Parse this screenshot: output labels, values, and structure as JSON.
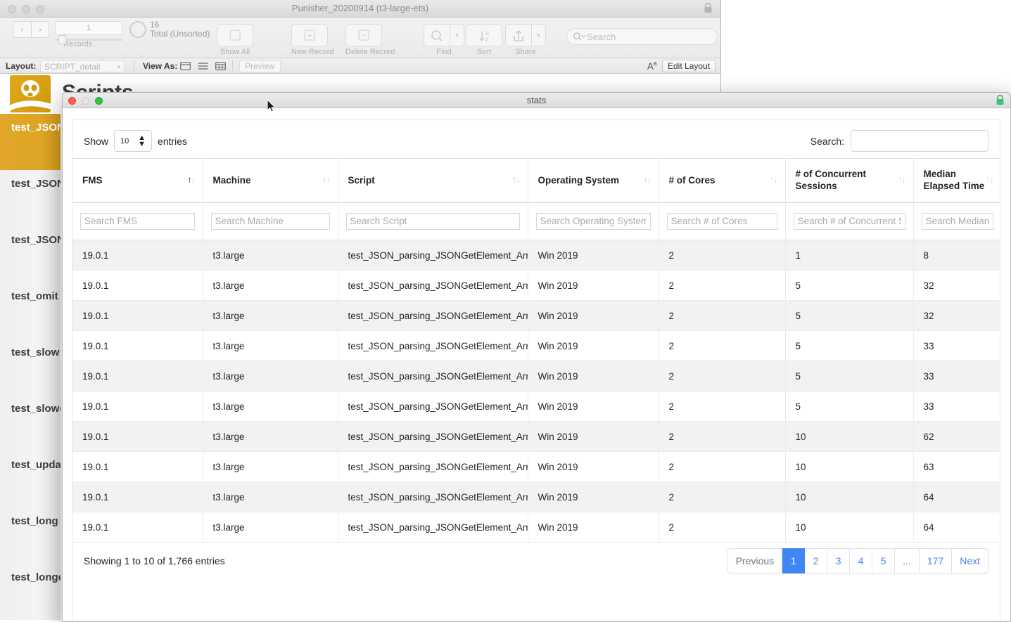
{
  "fm_window": {
    "title": "Punisher_20200914 (t3-large-ets)",
    "lock_icon": "lock-icon",
    "toolbar": {
      "record_index": "1",
      "record_total": "16",
      "record_total_label": "Total (Unsorted)",
      "records_label": "Records",
      "show_all_label": "Show All",
      "new_record_label": "New Record",
      "delete_record_label": "Delete Record",
      "find_label": "Find",
      "sort_label": "Sort",
      "share_label": "Share",
      "search_placeholder": "Search"
    },
    "layout_bar": {
      "layout_label": "Layout:",
      "layout_value": "SCRIPT_detail",
      "view_as_label": "View As:",
      "preview_label": "Preview",
      "text_format_icon": "text-format-icon",
      "edit_layout_label": "Edit Layout"
    },
    "body": {
      "heading": "Scripts",
      "logo_icon": "skull-logo-icon",
      "script_items": [
        {
          "label": "test_JSON_parsing_JSONGetElement_Array",
          "selected": true
        },
        {
          "label": "test_JSON_parsing_JSONGetElement_Object",
          "selected": false
        },
        {
          "label": "test_JSON_parsing_JSONGetElement_Nested",
          "selected": false
        },
        {
          "label": "test_omit",
          "selected": false
        },
        {
          "label": "test_slow",
          "selected": false
        },
        {
          "label": "test_slower",
          "selected": false
        },
        {
          "label": "test_update",
          "selected": false
        },
        {
          "label": "test_long",
          "selected": false
        },
        {
          "label": "test_longer",
          "selected": false
        }
      ]
    }
  },
  "stats_window": {
    "title": "stats",
    "lock_icon": "lock-icon-green",
    "traffic_lights": [
      "close",
      "minimize",
      "maximize"
    ],
    "datatable": {
      "length_prefix": "Show",
      "length_value": "10",
      "length_suffix": "entries",
      "filter_label": "Search:",
      "filter_value": "",
      "columns": [
        {
          "label": "FMS",
          "search_placeholder": "Search FMS",
          "sorted": "asc"
        },
        {
          "label": "Machine",
          "search_placeholder": "Search Machine",
          "sorted": "none"
        },
        {
          "label": "Script",
          "search_placeholder": "Search Script",
          "sorted": "none"
        },
        {
          "label": "Operating System",
          "search_placeholder": "Search Operating System",
          "sorted": "none"
        },
        {
          "label": "# of Cores",
          "search_placeholder": "Search # of Cores",
          "sorted": "none"
        },
        {
          "label": "# of Concurrent Sessions",
          "search_placeholder": "Search # of Concurrent Se",
          "sorted": "none"
        },
        {
          "label": "Median Elapsed Time",
          "search_placeholder": "Search Median Elapsed Time",
          "sorted": "none"
        }
      ],
      "rows": [
        [
          "19.0.1",
          "t3.large",
          "test_JSON_parsing_JSONGetElement_Array",
          "Win 2019",
          "2",
          "1",
          "8"
        ],
        [
          "19.0.1",
          "t3.large",
          "test_JSON_parsing_JSONGetElement_Array",
          "Win 2019",
          "2",
          "5",
          "32"
        ],
        [
          "19.0.1",
          "t3.large",
          "test_JSON_parsing_JSONGetElement_Array",
          "Win 2019",
          "2",
          "5",
          "32"
        ],
        [
          "19.0.1",
          "t3.large",
          "test_JSON_parsing_JSONGetElement_Array",
          "Win 2019",
          "2",
          "5",
          "33"
        ],
        [
          "19.0.1",
          "t3.large",
          "test_JSON_parsing_JSONGetElement_Array",
          "Win 2019",
          "2",
          "5",
          "33"
        ],
        [
          "19.0.1",
          "t3.large",
          "test_JSON_parsing_JSONGetElement_Array",
          "Win 2019",
          "2",
          "5",
          "33"
        ],
        [
          "19.0.1",
          "t3.large",
          "test_JSON_parsing_JSONGetElement_Array",
          "Win 2019",
          "2",
          "10",
          "62"
        ],
        [
          "19.0.1",
          "t3.large",
          "test_JSON_parsing_JSONGetElement_Array",
          "Win 2019",
          "2",
          "10",
          "63"
        ],
        [
          "19.0.1",
          "t3.large",
          "test_JSON_parsing_JSONGetElement_Array",
          "Win 2019",
          "2",
          "10",
          "64"
        ],
        [
          "19.0.1",
          "t3.large",
          "test_JSON_parsing_JSONGetElement_Array",
          "Win 2019",
          "2",
          "10",
          "64"
        ]
      ],
      "info": "Showing 1 to 10 of 1,766 entries",
      "pagination": [
        "Previous",
        "1",
        "2",
        "3",
        "4",
        "5",
        "...",
        "177",
        "Next"
      ],
      "active_page": "1"
    }
  },
  "colors": {
    "accent_blue": "#4285f4",
    "sidebar_selected": "#e2a72a",
    "row_stripe": "#f2f2f2"
  }
}
